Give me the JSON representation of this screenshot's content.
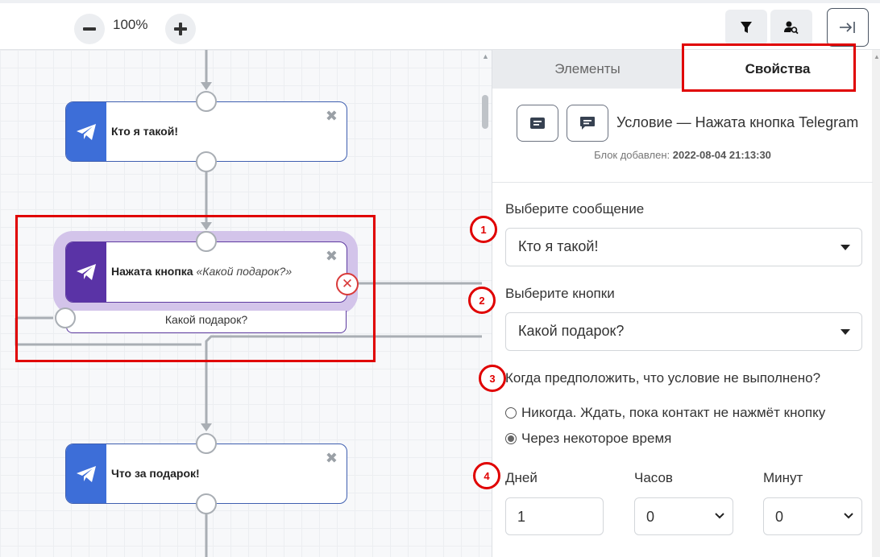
{
  "toolbar": {
    "zoom_out": "−",
    "zoom_level": "100%",
    "zoom_in": "+"
  },
  "canvas": {
    "nodes": [
      {
        "title": "Кто я такой!"
      },
      {
        "title": "Нажата кнопка",
        "title_quote": "«Какой подарок?»",
        "button_label": "Какой подарок?"
      },
      {
        "title": "Что за подарок!"
      }
    ],
    "close_symbol": "✖",
    "delete_symbol": "✕"
  },
  "panel": {
    "tabs": [
      "Элементы",
      "Свойства"
    ],
    "active_tab": "Свойства",
    "block_title": "Условие — Нажата кнопка Telegram",
    "added_label": "Блок добавлен:",
    "added_value": "2022-08-04 21:13:30",
    "message_label": "Выберите сообщение",
    "message_value": "Кто я такой!",
    "buttons_label": "Выберите кнопки",
    "buttons_value": "Какой подарок?",
    "condition_label": "Когда предположить, что условие не выполнено?",
    "radio_never": "Никогда. Ждать, пока контакт не нажмёт кнопку",
    "radio_after": "Через некоторое время",
    "days_label": "Дней",
    "hours_label": "Часов",
    "minutes_label": "Минут",
    "days_value": "1",
    "hours_value": "0",
    "minutes_value": "0"
  },
  "steps": [
    "1",
    "2",
    "3",
    "4"
  ],
  "colors": {
    "node_blue": "#3d6ed8",
    "node_purple": "#5a33a6",
    "highlight_red": "#e00000"
  }
}
